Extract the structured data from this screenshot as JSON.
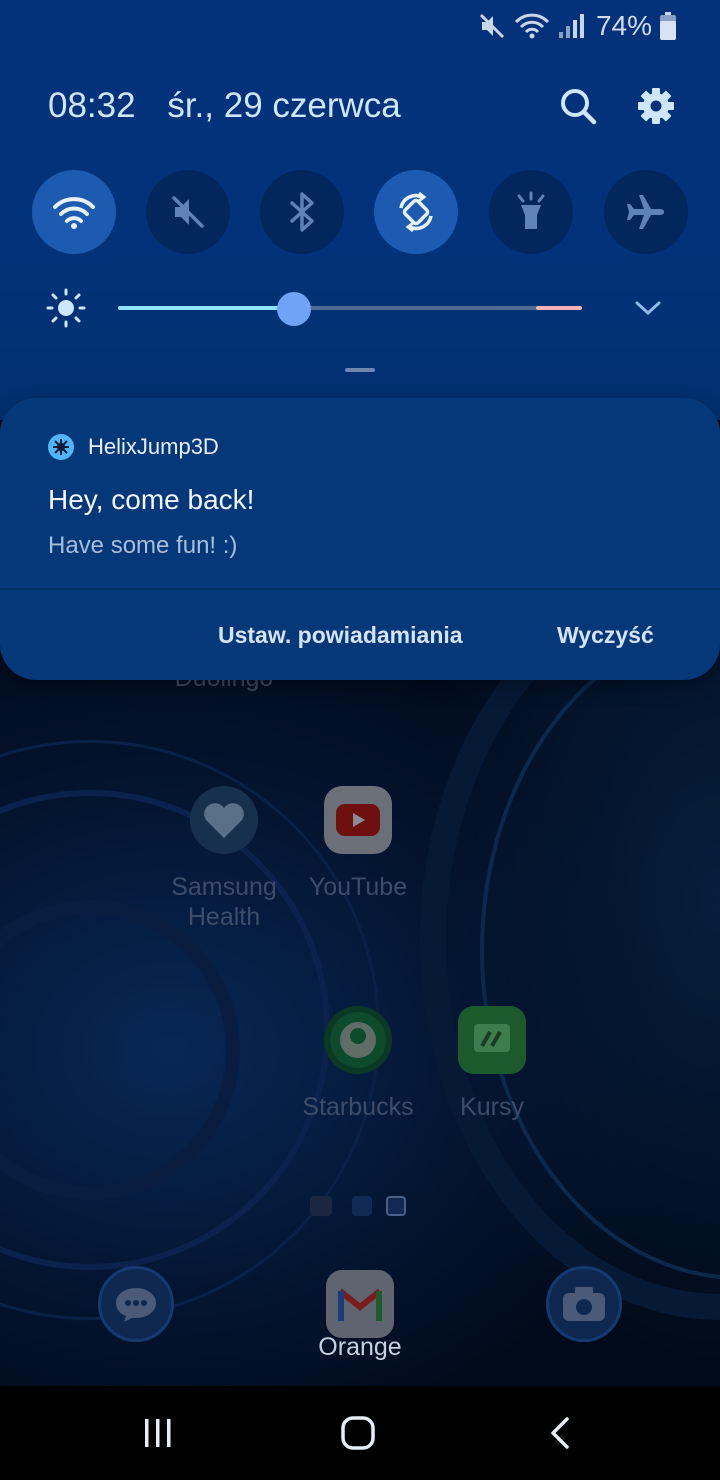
{
  "status_bar": {
    "battery_percent": "74%",
    "icons": [
      "mute-icon",
      "wifi-icon",
      "signal-icon",
      "battery-icon"
    ]
  },
  "header": {
    "time": "08:32",
    "date": "śr., 29 czerwca",
    "icons": [
      "search-icon",
      "settings-icon"
    ]
  },
  "quick_toggles": [
    {
      "name": "wifi",
      "icon": "wifi-icon",
      "on": true
    },
    {
      "name": "sound",
      "icon": "mute-icon",
      "on": false
    },
    {
      "name": "bluetooth",
      "icon": "bluetooth-icon",
      "on": false
    },
    {
      "name": "auto-rotate",
      "icon": "rotate-icon",
      "on": true
    },
    {
      "name": "flashlight",
      "icon": "flashlight-icon",
      "on": false
    },
    {
      "name": "airplane",
      "icon": "airplane-icon",
      "on": false
    }
  ],
  "brightness": {
    "level": 0.38
  },
  "notification": {
    "app_name": "HelixJump3D",
    "title": "Hey, come back!",
    "body": "Have some fun! :)",
    "actions": {
      "settings": "Ustaw. powiadamiania",
      "clear": "Wyczyść"
    }
  },
  "home_screen": {
    "partial_label": "Duolingo",
    "apps": {
      "samsung_health": "Samsung Health",
      "youtube": "YouTube",
      "starbucks": "Starbucks",
      "kursy": "Kursy"
    },
    "dock_label": "Orange"
  },
  "colors": {
    "panel": "#03327a",
    "notification": "#043878",
    "toggle_on": "#1d5bb0",
    "accent_text": "#cfe6ff"
  }
}
